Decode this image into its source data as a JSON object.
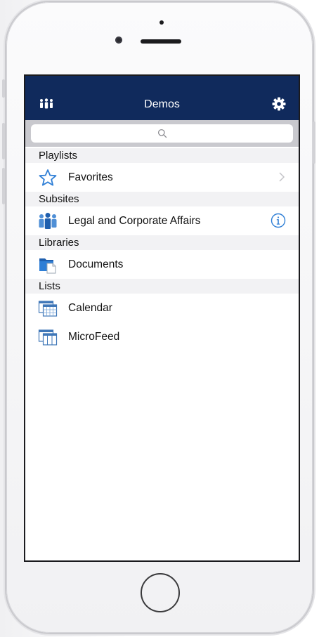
{
  "nav": {
    "title": "Demos",
    "left_icon": "people-group-icon",
    "right_icon": "gear-icon"
  },
  "search": {
    "placeholder": "",
    "icon": "search-icon"
  },
  "sections": {
    "playlists": {
      "header": "Playlists",
      "items": [
        {
          "label": "Favorites",
          "icon": "star-outline-icon",
          "accessory": "chevron-right-icon"
        }
      ]
    },
    "subsites": {
      "header": "Subsites",
      "items": [
        {
          "label": "Legal and Corporate Affairs",
          "icon": "team-icon",
          "accessory": "info-icon"
        }
      ]
    },
    "libraries": {
      "header": "Libraries",
      "items": [
        {
          "label": "Documents",
          "icon": "document-library-icon"
        }
      ]
    },
    "lists": {
      "header": "Lists",
      "items": [
        {
          "label": "Calendar",
          "icon": "calendar-list-icon"
        },
        {
          "label": "MicroFeed",
          "icon": "table-list-icon"
        }
      ]
    }
  },
  "colors": {
    "nav_background": "#102a5c",
    "accent_blue": "#2f7fd6",
    "section_background": "#f2f2f4",
    "search_bar_background": "#c9c9ce"
  }
}
